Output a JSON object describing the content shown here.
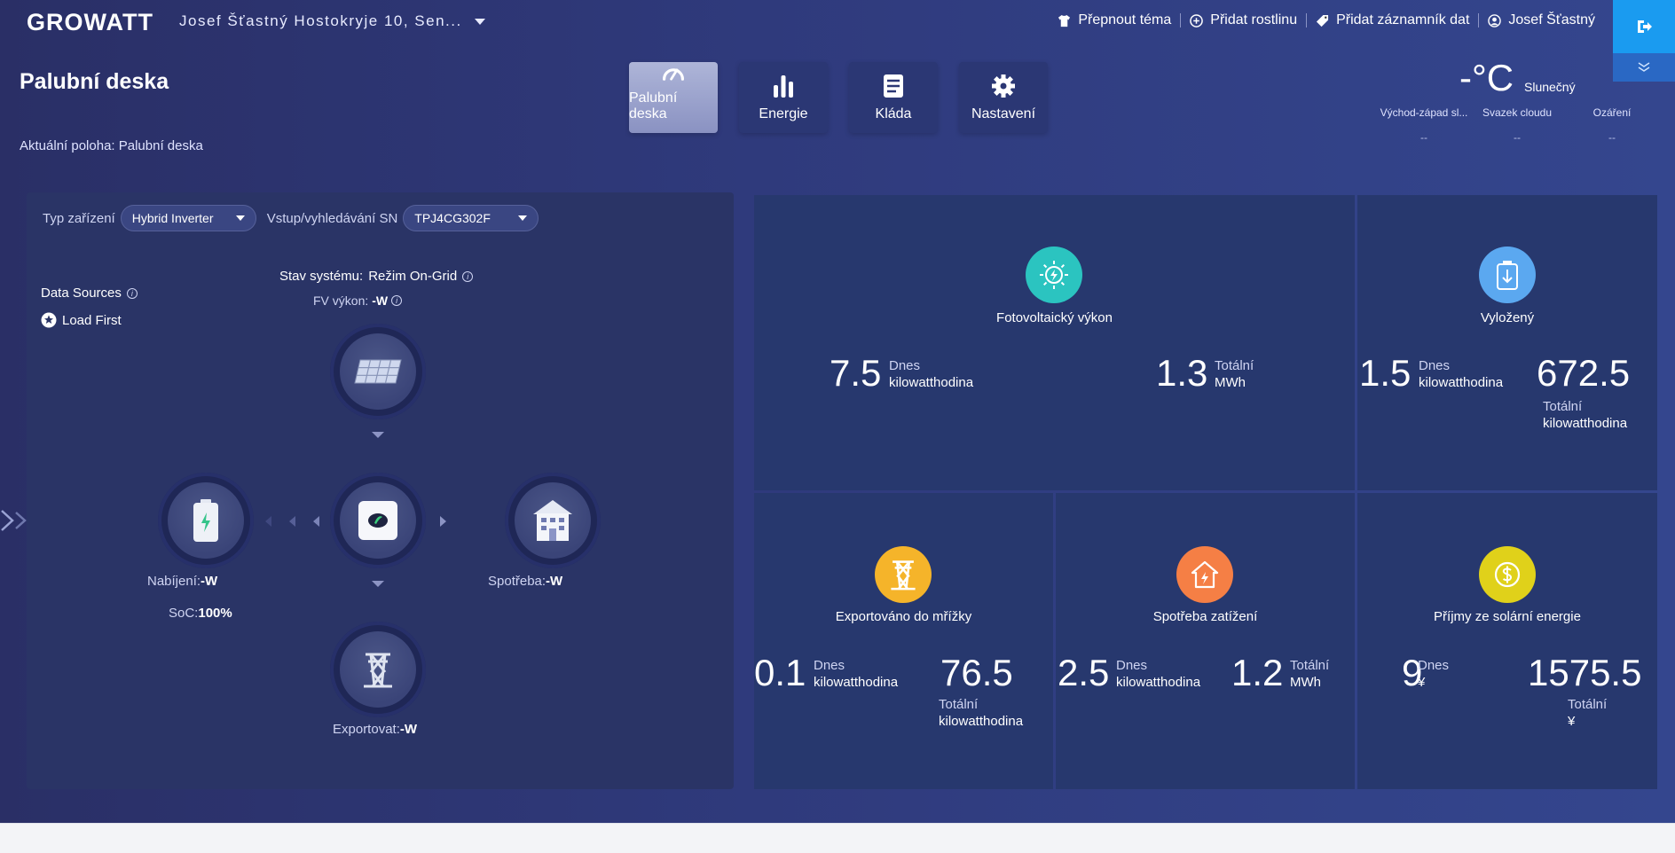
{
  "brand": {
    "logo": "GROWATT"
  },
  "header": {
    "plant_name": "Josef Šťastný Hostokryje 10, Sen...",
    "links": {
      "theme": "Přepnout téma",
      "add_plant": "Přidat rostlinu",
      "add_logger": "Přidat záznamník dat",
      "user": "Josef Šťastný"
    }
  },
  "page": {
    "title": "Palubní deska",
    "breadcrumb": "Aktuální poloha: Palubní deska"
  },
  "nav": {
    "tabs": [
      "Palubní deska",
      "Energie",
      "Kláda",
      "Nastavení"
    ],
    "active_index": 0
  },
  "weather": {
    "temp": "-°C",
    "condition": "Slunečný",
    "cols": [
      {
        "label": "Východ-západ sl...",
        "value": "--"
      },
      {
        "label": "Svazek cloudu",
        "value": "--"
      },
      {
        "label": "Ozáření",
        "value": "--"
      }
    ]
  },
  "filters": {
    "device_type_label": "Typ zařízení",
    "device_type_value": "Hybrid Inverter",
    "sn_label": "Vstup/vyhledávání SN",
    "sn_value": "TPJ4CG302F"
  },
  "flow": {
    "data_sources": "Data Sources",
    "load_first": "Load First",
    "system_state_label": "Stav systému:",
    "system_state_value": "Režim On-Grid",
    "pv_label": "FV výkon:",
    "pv_value": "-W",
    "charge_label": "Nabíjení:",
    "charge_value": "-W",
    "soc_label": "SoC:",
    "soc_value": "100%",
    "consumption_label": "Spotřeba:",
    "consumption_value": "-W",
    "export_label": "Exportovat:",
    "export_value": "-W"
  },
  "tiles": {
    "pv": {
      "title": "Fotovoltaický výkon",
      "today": "7.5",
      "today_label": "Dnes",
      "today_unit": "kilowatthodina",
      "total": "1.3",
      "total_label": "Totální",
      "total_unit": "MWh",
      "color": "#2bc4c0"
    },
    "discharged": {
      "title": "Vyložený",
      "today": "1.5",
      "today_label": "Dnes",
      "today_unit": "kilowatthodina",
      "total": "672.5",
      "total_label": "Totální",
      "total_unit": "kilowatthodina",
      "color": "#5ba8f0"
    },
    "export": {
      "title": "Exportováno do mřížky",
      "today": "0.1",
      "today_label": "Dnes",
      "today_unit": "kilowatthodina",
      "total": "76.5",
      "total_label": "Totální",
      "total_unit": "kilowatthodina",
      "color": "#f5b42a"
    },
    "load": {
      "title": "Spotřeba zatížení",
      "today": "2.5",
      "today_label": "Dnes",
      "today_unit": "kilowatthodina",
      "total": "1.2",
      "total_label": "Totální",
      "total_unit": "MWh",
      "color": "#f57f45"
    },
    "income": {
      "title": "Příjmy ze solární energie",
      "today": "9",
      "today_label": "Dnes",
      "today_unit": "¥",
      "total": "1575.5",
      "total_label": "Totální",
      "total_unit": "¥",
      "color": "#e0d11a"
    }
  }
}
